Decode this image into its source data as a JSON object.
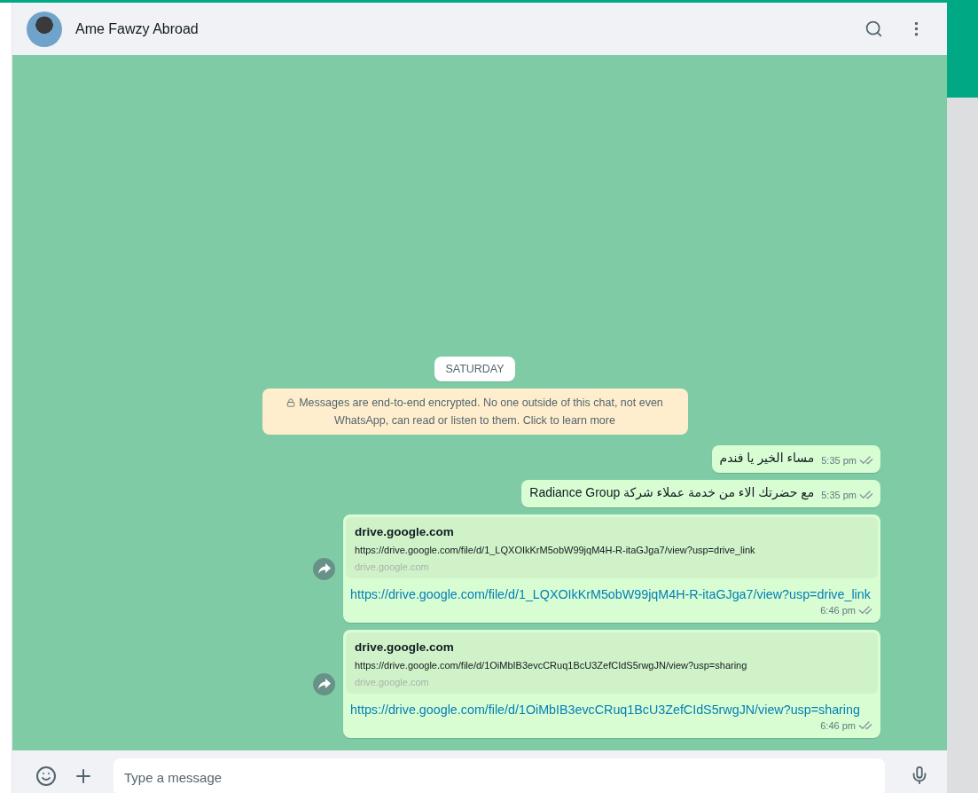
{
  "header": {
    "contact_name": "Ame Fawzy Abroad"
  },
  "date_chip": "SATURDAY",
  "encryption_notice": "Messages are end-to-end encrypted. No one outside of this chat, not even WhatsApp, can read or listen to them. Click to learn more",
  "messages": [
    {
      "kind": "text",
      "text": "مساء الخير يا فندم",
      "time": "5:35 pm"
    },
    {
      "kind": "text",
      "text": "مع حضرتك الاء من خدمة عملاء شركة Radiance Group",
      "time": "5:35 pm"
    },
    {
      "kind": "link",
      "preview_title": "drive.google.com",
      "preview_url": "https://drive.google.com/file/d/1_LQXOIkKrM5obW99jqM4H-R-itaGJga7/view?usp=drive_link",
      "preview_domain": "drive.google.com",
      "link": "https://drive.google.com/file/d/1_LQXOIkKrM5obW99jqM4H-R-itaGJga7/view?usp=drive_link",
      "time": "6:46 pm"
    },
    {
      "kind": "link",
      "preview_title": "drive.google.com",
      "preview_url": "https://drive.google.com/file/d/1OiMbIB3evcCRuq1BcU3ZefCIdS5rwgJN/view?usp=sharing",
      "preview_domain": "drive.google.com",
      "link": "https://drive.google.com/file/d/1OiMbIB3evcCRuq1BcU3ZefCIdS5rwgJN/view?usp=sharing",
      "time": "6:46 pm"
    }
  ],
  "composer": {
    "placeholder": "Type a message"
  }
}
